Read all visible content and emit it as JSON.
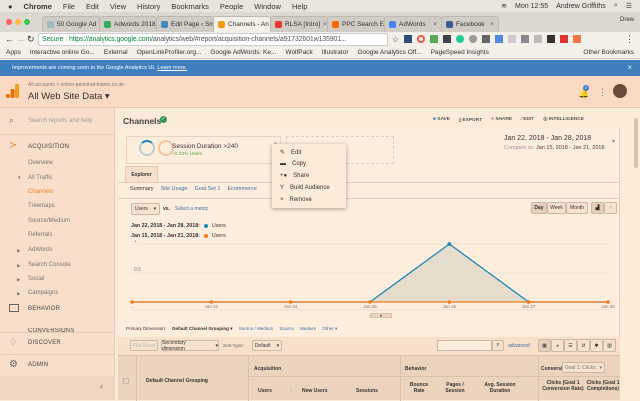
{
  "menubar": {
    "app": "Chrome",
    "items": [
      "File",
      "Edit",
      "View",
      "History",
      "Bookmarks",
      "People",
      "Window",
      "Help"
    ],
    "clock": "Mon 12:55",
    "user": "Andrew Griffiths"
  },
  "tabs": [
    {
      "label": "50 Google Ad",
      "color": "#9bb"
    },
    {
      "label": "Adwords 2018",
      "color": "#3a5"
    },
    {
      "label": "Edit Page ‹ Sm",
      "color": "#48b"
    },
    {
      "label": "Channels - An",
      "color": "#f39c12",
      "active": true
    },
    {
      "label": "RLSA [Intro]",
      "color": "#e33"
    },
    {
      "label": "PPC Search En",
      "color": "#f60"
    },
    {
      "label": "AdWords",
      "color": "#4285f4"
    },
    {
      "label": "Facebook",
      "color": "#3b5998"
    }
  ],
  "tabstrip_user": "Drew",
  "address": {
    "secure": "Secure",
    "url_host": "https://analytics.google.com",
    "url_path": "/analytics/web/#report/acquisition-channels/a91732601w135901..."
  },
  "bookmarks": [
    "Apps",
    "Interactive online Go...",
    "External",
    "OpenLinkProfiler.org...",
    "Google AdWords: Ke...",
    "WolfPack",
    "Illustrator",
    "Google Analytics Off...",
    "PageSpeed Insights",
    "Other Bookmarks"
  ],
  "banner": {
    "text": "Improvements are coming soon to the Google Analytics UI.",
    "link": "Learn more."
  },
  "ga_header": {
    "breadcrumb": "All accounts > online-personal-trainer.co.uk",
    "property": "All Web Site Data",
    "notifications": "2"
  },
  "sidebar": {
    "search": "Search reports and help",
    "section": "ACQUISITION",
    "items": [
      "Overview",
      "All Traffic",
      "Channels",
      "Treemaps",
      "Source/Medium",
      "Referrals",
      "AdWords",
      "Search Console",
      "Social",
      "Campaigns"
    ],
    "behavior": "BEHAVIOR",
    "conversions": "CONVERSIONS",
    "discover": "DISCOVER",
    "admin": "ADMIN"
  },
  "report": {
    "title": "Channels",
    "actions": [
      "SAVE",
      "EXPORT",
      "SHARE",
      "EDIT",
      "INTELLIGENCE"
    ],
    "segment": {
      "name": "Session Duration >240",
      "sub": "+0.33% Users"
    },
    "date": {
      "range": "Jan 22, 2018 - Jan 28, 2018",
      "compare_label": "Compare to:",
      "compare": "Jan 15, 2018 - Jan 21, 2018"
    },
    "menu": [
      "Edit",
      "Copy",
      "Share",
      "Build Audience",
      "Remove"
    ],
    "explorer_tab": "Explorer",
    "subtabs": [
      "Summary",
      "Site Usage",
      "Goal Set 1",
      "Ecommerce"
    ],
    "metric": "Users",
    "vs": "vs.",
    "select_metric": "Select a metric",
    "granularity": [
      "Day",
      "Week",
      "Month"
    ],
    "legend": [
      {
        "range": "Jan 22, 2018 - Jan 28, 2018:",
        "label": "Users",
        "color": "#1a87b8"
      },
      {
        "range": "Jan 15, 2018 - Jan 21, 2018:",
        "label": "Users",
        "color": "#f07c1c"
      }
    ],
    "primary_dimension_label": "Primary Dimension:",
    "dimensions": [
      "Default Channel Grouping",
      "Source / Medium",
      "Source",
      "Medium",
      "Other"
    ],
    "plot_rows": "Plot Rows",
    "secondary_dimension": "Secondary dimension",
    "sort_type_label": "Sort Type:",
    "sort_type": "Default",
    "advanced": "advanced",
    "table": {
      "dimension_header": "Default Channel Grouping",
      "groups": [
        "Acquisition",
        "Behavior",
        "Conversions"
      ],
      "goal_select": "Goal 1: Clicks",
      "columns": [
        "Users",
        "New Users",
        "Sessions",
        "Bounce Rate",
        "Pages / Session",
        "Avg. Session Duration",
        "Clicks (Goal 1 Conversion Rate)",
        "Clicks (Goal 1 Completions)"
      ]
    }
  },
  "chart_data": {
    "type": "line",
    "x": [
      "Jan 22",
      "Jan 23",
      "Jan 24",
      "Jan 25",
      "Jan 26",
      "Jan 27",
      "Jan 28"
    ],
    "xtick_labels": [
      "...",
      "Jan 23",
      "Jan 24",
      "Jan 25",
      "Jan 26",
      "Jan 27",
      "Jan 28"
    ],
    "yticks": [
      "0.5",
      "1"
    ],
    "ylim": [
      0,
      1
    ],
    "grid": true,
    "series": [
      {
        "name": "Users",
        "period": "Jan 22, 2018 - Jan 28, 2018",
        "color": "#1a87b8",
        "values": [
          0,
          0,
          0,
          0,
          1,
          0,
          0
        ],
        "area": true
      },
      {
        "name": "Users",
        "period": "Jan 15, 2018 - Jan 21, 2018",
        "color": "#f07c1c",
        "values": [
          0,
          0,
          0,
          0,
          0,
          0,
          0
        ]
      }
    ]
  }
}
